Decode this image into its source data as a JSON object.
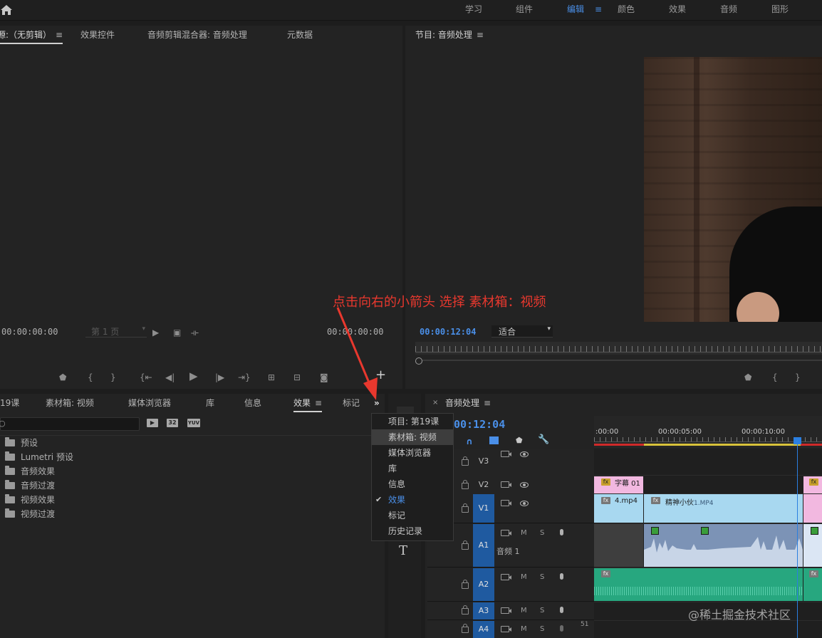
{
  "workspace": {
    "tabs": [
      "学习",
      "组件",
      "编辑",
      "颜色",
      "效果",
      "音频",
      "图形"
    ],
    "active": "编辑",
    "menu_icon": "≡"
  },
  "source_panel": {
    "tabs": [
      "源:（无剪辑）",
      "效果控件",
      "音频剪辑混合器: 音频处理",
      "元数据"
    ],
    "timecode_left": "00:00:00:00",
    "timecode_right": "00:00:00:00",
    "page_select": "第 1 页"
  },
  "program_panel": {
    "title": "节目: 音频处理",
    "timecode": "00:00:12:04",
    "fit_select": "适合"
  },
  "project_panel": {
    "tabs": [
      "19课",
      "素材箱: 视频",
      "媒体浏览器",
      "库",
      "信息",
      "效果",
      "标记"
    ],
    "active_tab": "效果",
    "search_placeholder": "",
    "badges": [
      "32",
      "YUV"
    ],
    "tree": [
      "预设",
      "Lumetri 预设",
      "音频效果",
      "音频过渡",
      "视频效果",
      "视频过渡"
    ]
  },
  "overflow_menu": {
    "items": [
      "项目: 第19课",
      "素材箱: 视频",
      "媒体浏览器",
      "库",
      "信息",
      "效果",
      "标记",
      "历史记录"
    ],
    "highlighted": "素材箱: 视频",
    "checked": "效果"
  },
  "annotation": {
    "text": "点击向右的小箭头 选择 素材箱：视频",
    "color": "#e8382e"
  },
  "timeline": {
    "title": "音频处理",
    "timecode": "00:12:04",
    "ruler": [
      ":00:00",
      "00:00:05:00",
      "00:00:10:00"
    ],
    "tracks": [
      {
        "name": "V3"
      },
      {
        "name": "V2"
      },
      {
        "name": "V1"
      },
      {
        "name": "A1",
        "label": "音频 1"
      },
      {
        "name": "A2"
      },
      {
        "name": "A3"
      },
      {
        "name": "A4"
      }
    ],
    "track_btns": {
      "m": "M",
      "s": "S"
    },
    "a4_extra": "51",
    "clips": {
      "title_clip": "字幕 01",
      "v1_a": "4.mp4",
      "v1_b": "精神小伙",
      "v1_b_suffix": "1.MP4"
    }
  },
  "watermark": "@稀土掘金技术社区",
  "colors": {
    "accent_blue": "#4a8fe8",
    "video_clip": "#a8d8f0",
    "title_clip": "#f2b8e0",
    "audio_clip": "#7c93b6",
    "audio_clip2": "#27a77f",
    "playhead": "#2b7fe0"
  },
  "icons": {
    "home": "home-icon",
    "overflow": "double-chevron-right-icon",
    "type_tool": "type-tool-icon",
    "wrench": "wrench-icon",
    "magnet": "snap-magnet-icon"
  }
}
